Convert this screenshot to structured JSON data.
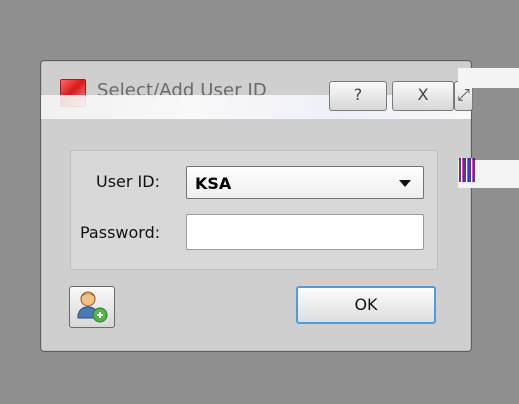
{
  "window": {
    "title": "Select/Add User ID"
  },
  "titlebar": {
    "help": "?",
    "close": "X",
    "restore": "⤢"
  },
  "form": {
    "user_id_label": "User ID:",
    "user_id_value": "KSA",
    "password_label": "Password:"
  },
  "buttons": {
    "ok": "OK"
  },
  "colors": {
    "background": "#8f8f8f",
    "dialog": "#cfcfcf",
    "accent": "#4d9ed8"
  },
  "icons": {
    "app": "app-icon",
    "add_user": "add-user-icon",
    "help": "help-icon",
    "close": "close-icon",
    "dropdown": "chevron-down-icon"
  }
}
